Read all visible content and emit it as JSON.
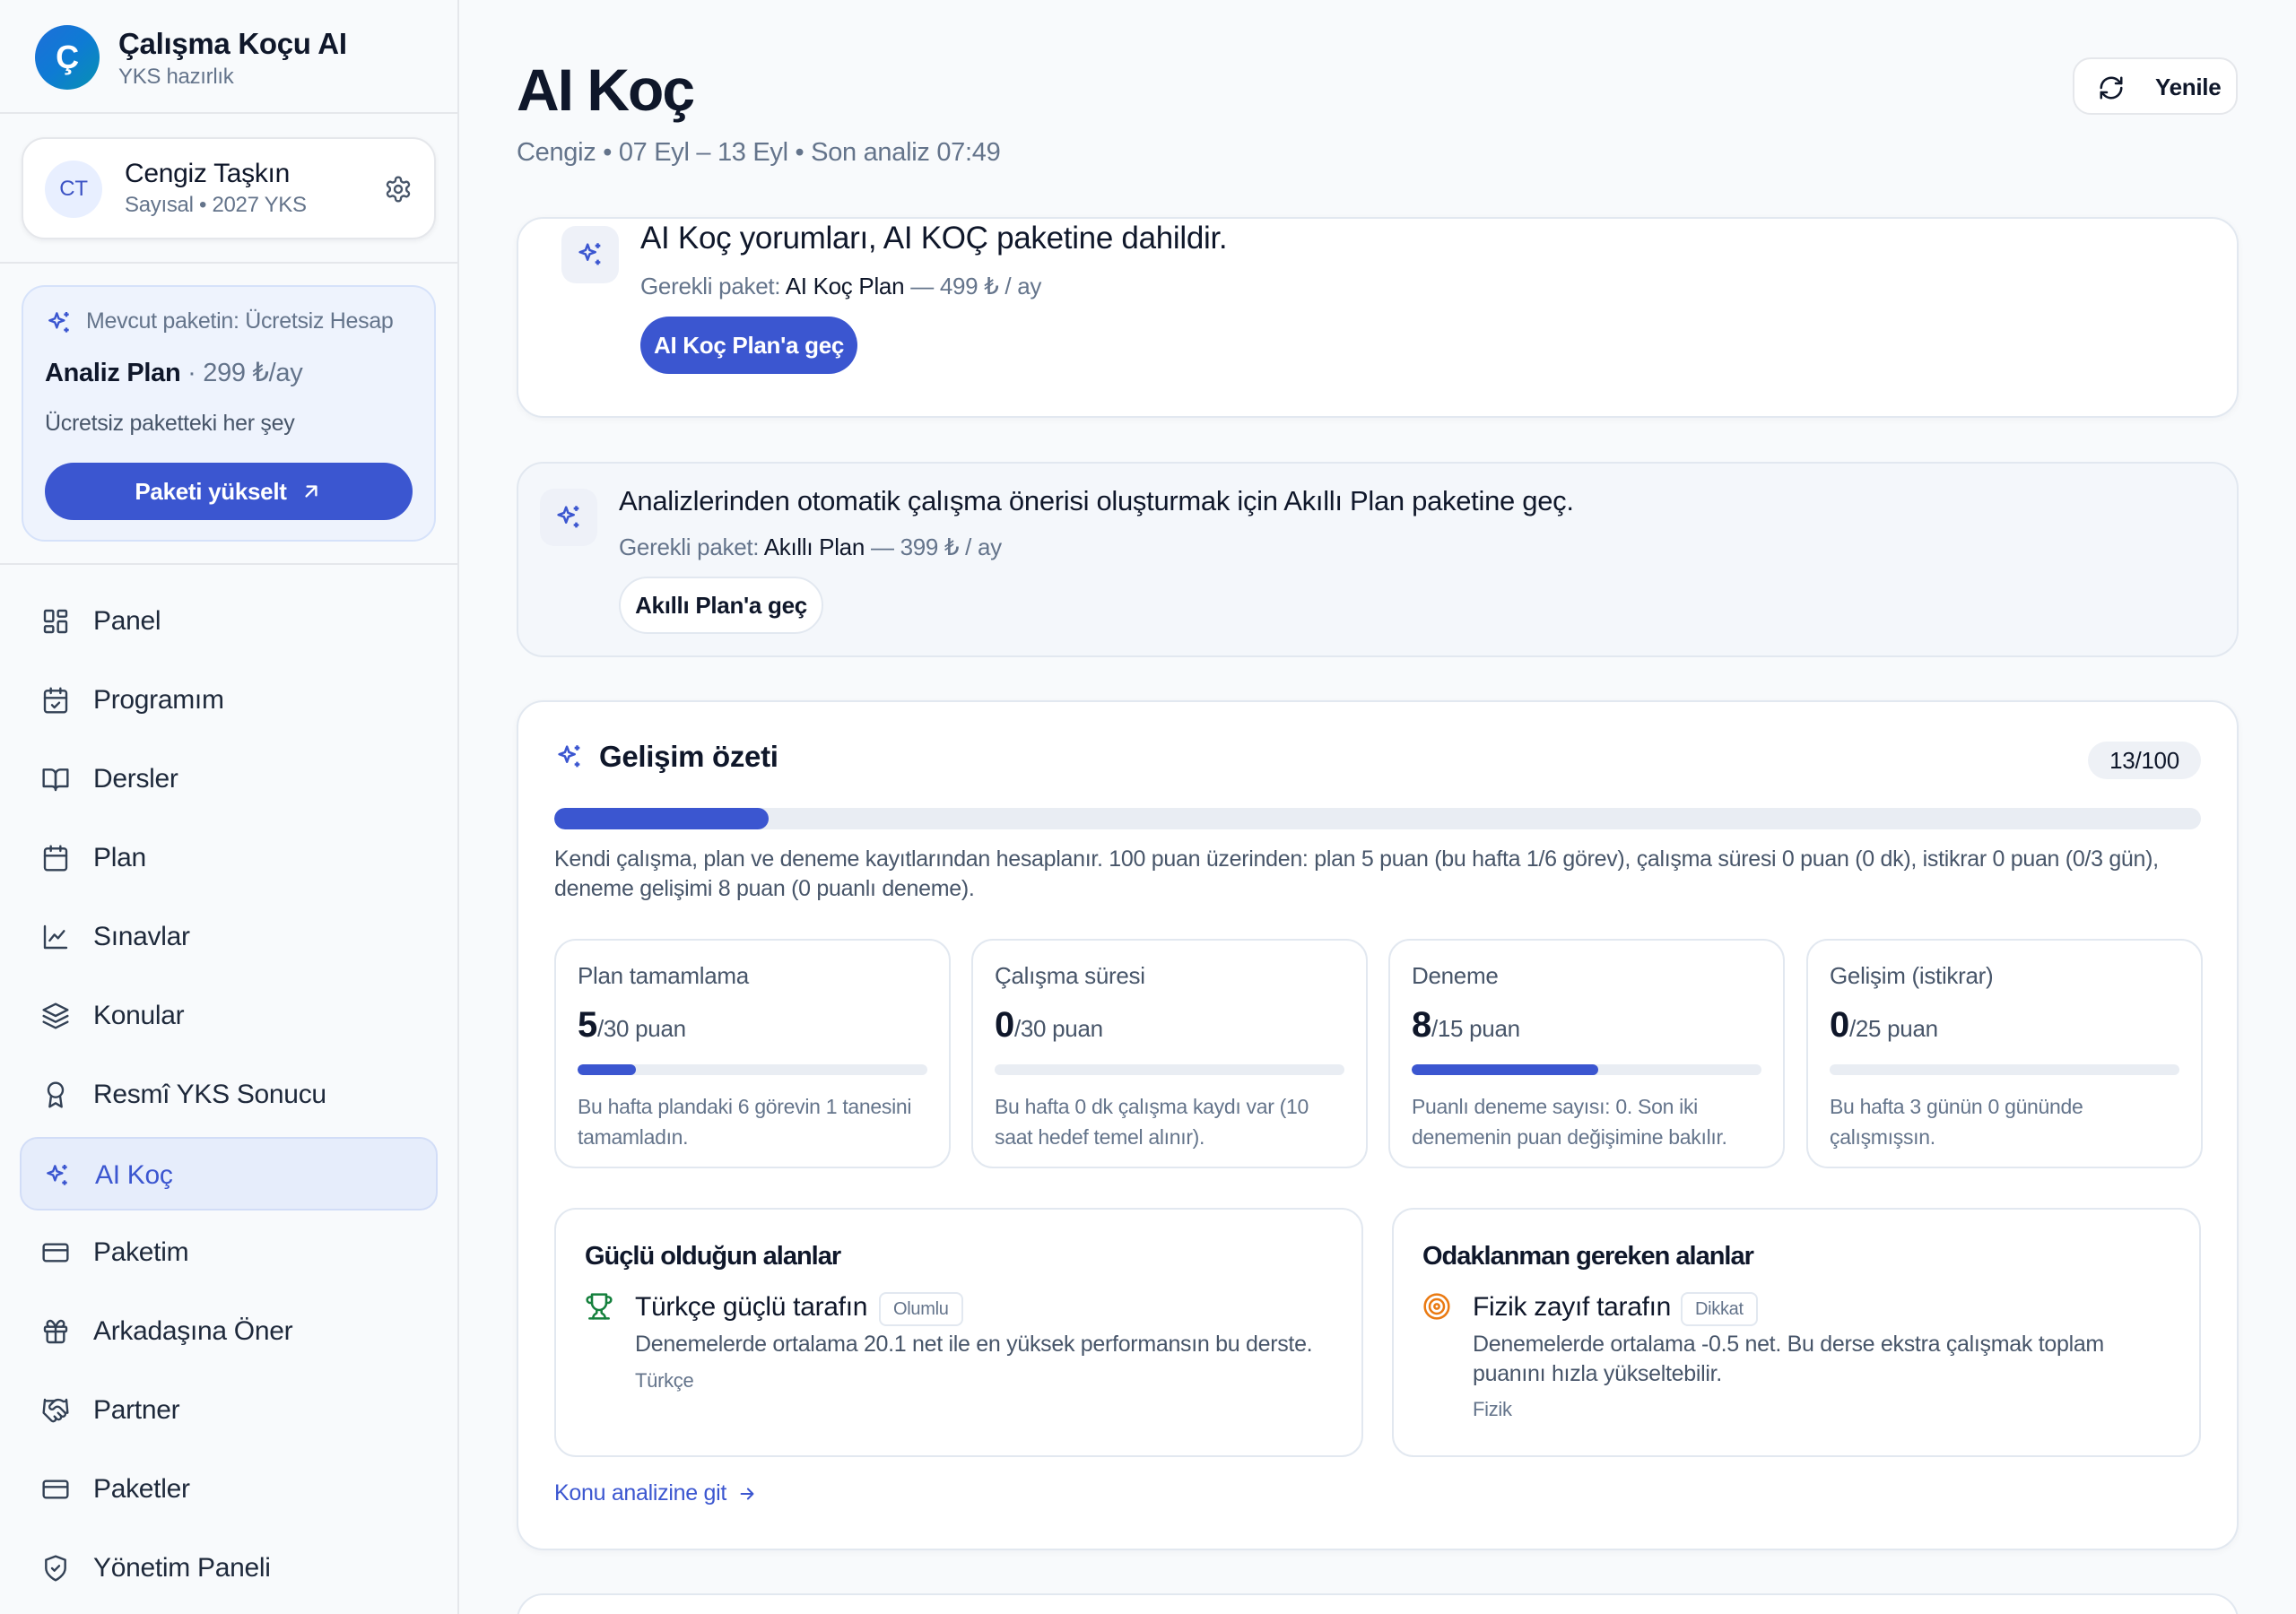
{
  "brand": {
    "logo_letter": "Ç",
    "name": "Çalışma Koçu AI",
    "subtitle": "YKS hazırlık"
  },
  "user": {
    "initials": "CT",
    "name": "Cengiz Taşkın",
    "subtitle": "Sayısal • 2027 YKS"
  },
  "plan_card": {
    "current": "Mevcut paketin: Ücretsiz Hesap",
    "plan_name": "Analiz Plan",
    "plan_price": " · 299 ₺/ay",
    "description": "Ücretsiz paketteki her şey",
    "upgrade_label": "Paketi yükselt"
  },
  "nav": [
    {
      "label": "Panel",
      "icon": "dashboard-icon",
      "active": false
    },
    {
      "label": "Programım",
      "icon": "calendar-check-icon",
      "active": false
    },
    {
      "label": "Dersler",
      "icon": "book-open-icon",
      "active": false
    },
    {
      "label": "Plan",
      "icon": "calendar-icon",
      "active": false
    },
    {
      "label": "Sınavlar",
      "icon": "line-chart-icon",
      "active": false
    },
    {
      "label": "Konular",
      "icon": "layers-icon",
      "active": false
    },
    {
      "label": "Resmî YKS Sonucu",
      "icon": "award-icon",
      "active": false
    },
    {
      "label": "AI Koç",
      "icon": "sparkles-icon",
      "active": true
    },
    {
      "label": "Paketim",
      "icon": "credit-card-icon",
      "active": false
    },
    {
      "label": "Arkadaşına Öner",
      "icon": "gift-icon",
      "active": false
    },
    {
      "label": "Partner",
      "icon": "handshake-icon",
      "active": false
    },
    {
      "label": "Paketler",
      "icon": "credit-card-icon",
      "active": false
    },
    {
      "label": "Yönetim Paneli",
      "icon": "shield-icon",
      "active": false
    }
  ],
  "header": {
    "title": "AI Koç",
    "meta": "Cengiz • 07 Eyl – 13 Eyl • Son analiz 07:49",
    "refresh_label": "Yenile"
  },
  "upsell_ai": {
    "title": "AI Koç yorumları, AI KOÇ paketine dahildir.",
    "required_prefix": "Gerekli paket: ",
    "required_plan": "AI Koç Plan",
    "required_price": " — 499 ₺ / ay",
    "button": "AI Koç Plan'a geç"
  },
  "upsell_smart": {
    "title": "Analizlerinden otomatik çalışma önerisi oluşturmak için Akıllı Plan paketine geç.",
    "required_prefix": "Gerekli paket: ",
    "required_plan": "Akıllı Plan",
    "required_price": " — 399 ₺ / ay",
    "button": "Akıllı Plan'a geç"
  },
  "progress": {
    "title": "Gelişim özeti",
    "score": 13,
    "score_max": 100,
    "score_label": "13/100",
    "description": "Kendi çalışma, plan ve deneme kayıtlarından hesaplanır. 100 puan üzerinden: plan 5 puan (bu hafta 1/6 görev), çalışma süresi 0 puan (0 dk), istikrar 0 puan (0/3 gün), deneme gelişimi 8 puan (0 puanlı deneme).",
    "metrics": [
      {
        "label": "Plan tamamlama",
        "value": "5",
        "max_label": "/30 puan",
        "fraction": 0.1667,
        "note": "Bu hafta plandaki 6 görevin 1 tanesini tamamladın."
      },
      {
        "label": "Çalışma süresi",
        "value": "0",
        "max_label": "/30 puan",
        "fraction": 0,
        "note": "Bu hafta 0 dk çalışma kaydı var (10 saat hedef temel alınır)."
      },
      {
        "label": "Deneme",
        "value": "8",
        "max_label": "/15 puan",
        "fraction": 0.5333,
        "note": "Puanlı deneme sayısı: 0. Son iki denemenin puan değişimine bakılır."
      },
      {
        "label": "Gelişim (istikrar)",
        "value": "0",
        "max_label": "/25 puan",
        "fraction": 0,
        "note": "Bu hafta 3 günün 0 gününde çalışmışsın."
      }
    ],
    "strong": {
      "title": "Güçlü olduğun alanlar",
      "item_title": "Türkçe güçlü tarafın",
      "badge": "Olumlu",
      "description": "Denemelerde ortalama 20.1 net ile en yüksek performansın bu derste.",
      "subject": "Türkçe"
    },
    "focus": {
      "title": "Odaklanman gereken alanlar",
      "item_title": "Fizik zayıf tarafın",
      "badge": "Dikkat",
      "description": "Denemelerde ortalama -0.5 net. Bu derse ekstra çalışmak toplam puanını hızla yükseltebilir.",
      "subject": "Fizik"
    },
    "link_label": "Konu analizine git"
  },
  "colors": {
    "accent": "#3b56d0",
    "active_bg": "#e6edfb",
    "positive": "#15803d",
    "warning": "#ea7a12"
  }
}
